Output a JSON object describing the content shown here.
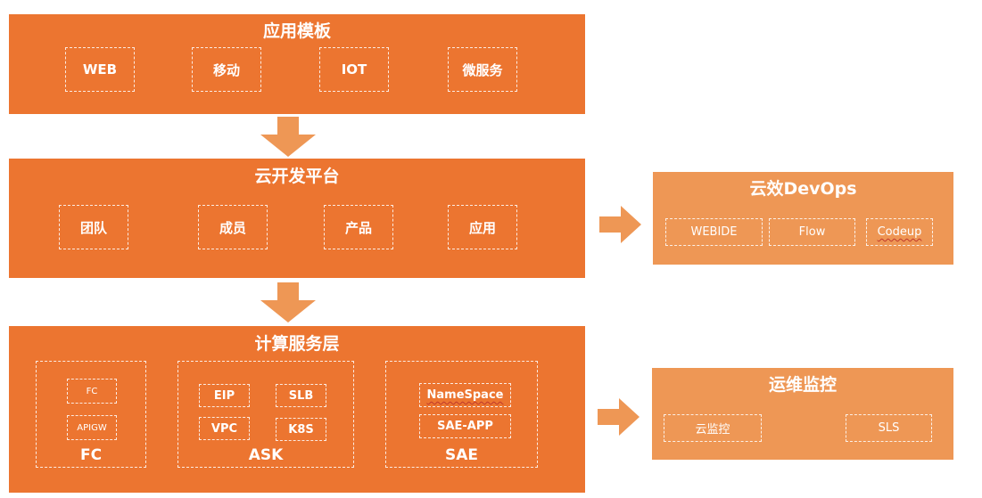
{
  "colors": {
    "layer_main": "#ec7530",
    "layer_side": "#ee9755",
    "arrow": "#ee9755",
    "text": "#ffffff"
  },
  "app_template": {
    "title": "应用模板",
    "items": [
      "WEB",
      "移动",
      "IOT",
      "微服务"
    ]
  },
  "cloud_dev_platform": {
    "title": "云开发平台",
    "items": [
      "团队",
      "成员",
      "产品",
      "应用"
    ]
  },
  "compute_layer": {
    "title": "计算服务层",
    "groups": [
      {
        "label": "FC",
        "items": [
          "FC",
          "APIGW"
        ]
      },
      {
        "label": "ASK",
        "items": [
          "EIP",
          "SLB",
          "VPC",
          "K8S"
        ]
      },
      {
        "label": "SAE",
        "items": [
          "NameSpace",
          "SAE-APP"
        ]
      }
    ]
  },
  "devops": {
    "title": "云效DevOps",
    "items": [
      "WEBIDE",
      "Flow",
      "Codeup"
    ]
  },
  "ops_monitoring": {
    "title": "运维监控",
    "items": [
      "云监控",
      "SLS"
    ]
  },
  "icons": {
    "down_arrow": "arrow-down-icon",
    "right_arrow": "arrow-right-icon"
  }
}
